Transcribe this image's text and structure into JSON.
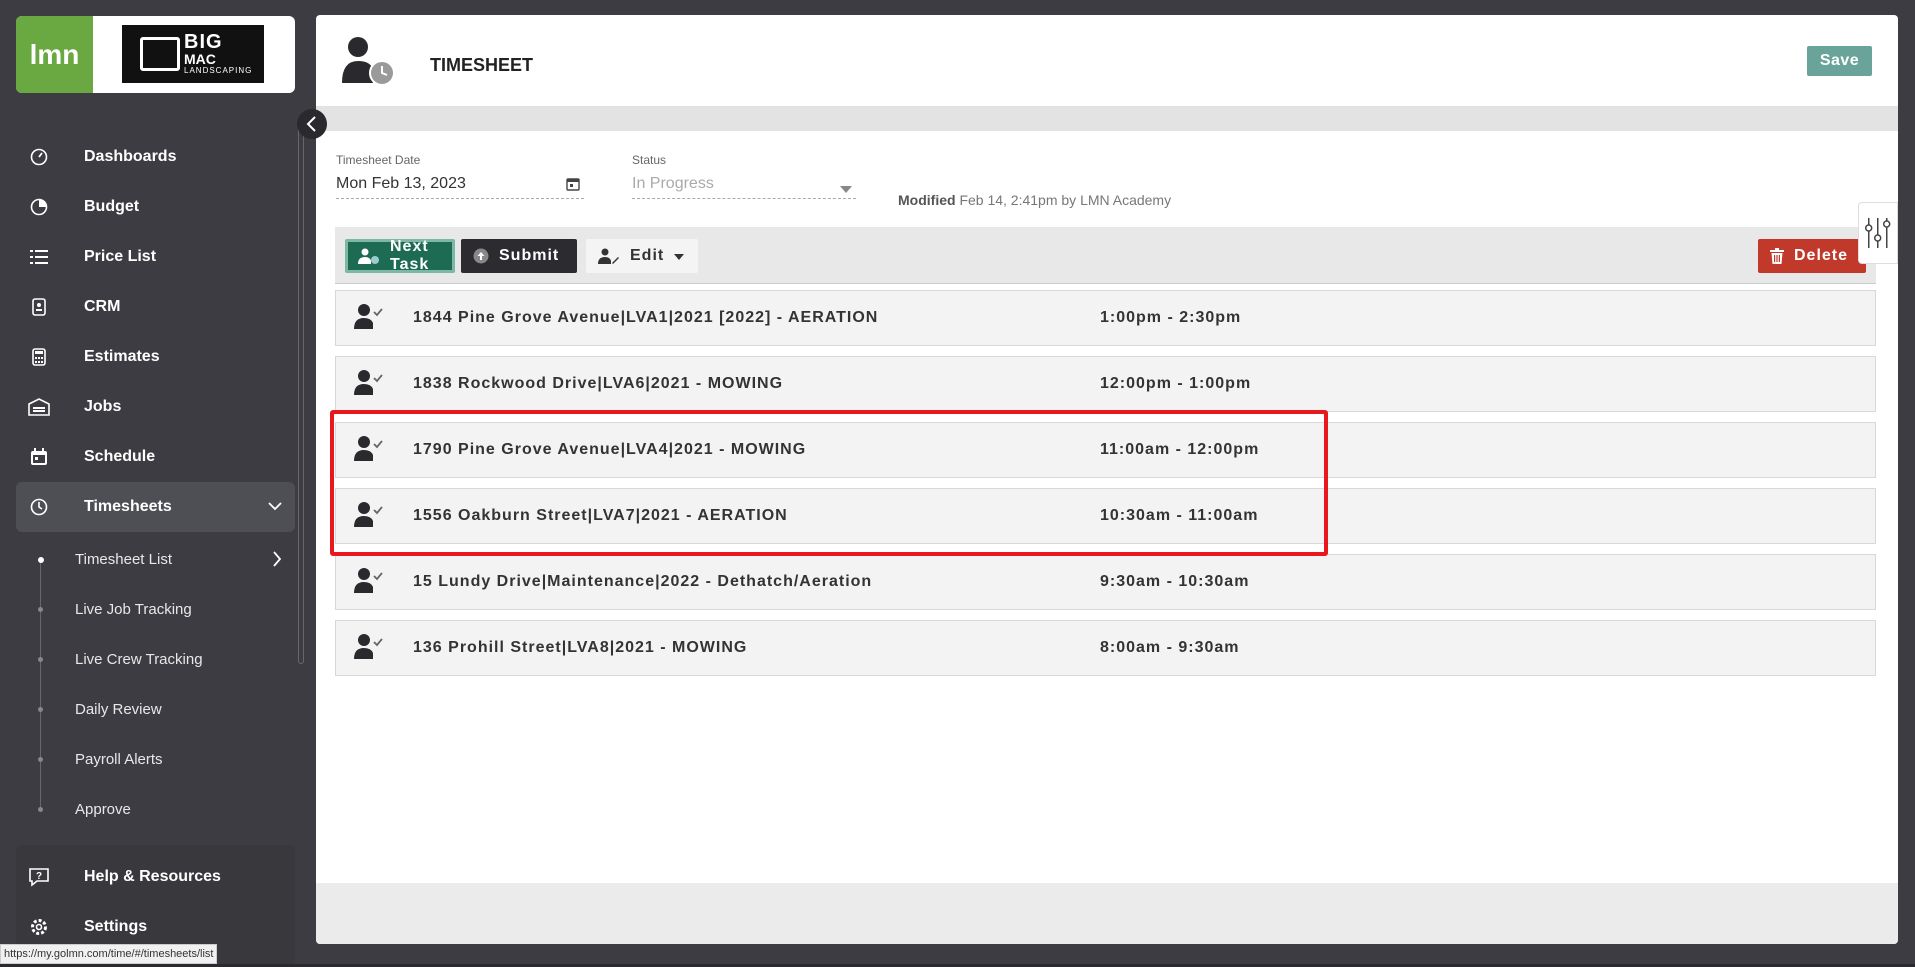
{
  "sidebar": {
    "logo_lmn": "lmn",
    "logo_big_line1": "BIG",
    "logo_big_line2": "MAC",
    "logo_big_line3": "LANDSCAPING",
    "nav": [
      {
        "label": "Dashboards",
        "icon": "gauge-icon"
      },
      {
        "label": "Budget",
        "icon": "pie-chart-icon"
      },
      {
        "label": "Price List",
        "icon": "list-icon"
      },
      {
        "label": "CRM",
        "icon": "contact-card-icon"
      },
      {
        "label": "Estimates",
        "icon": "calculator-icon"
      },
      {
        "label": "Jobs",
        "icon": "garage-icon"
      },
      {
        "label": "Schedule",
        "icon": "calendar-icon"
      },
      {
        "label": "Timesheets",
        "icon": "clock-icon"
      }
    ],
    "sub_items": [
      {
        "label": "Timesheet List"
      },
      {
        "label": "Live Job Tracking"
      },
      {
        "label": "Live Crew Tracking"
      },
      {
        "label": "Daily Review"
      },
      {
        "label": "Payroll Alerts"
      },
      {
        "label": "Approve"
      }
    ],
    "bottom": [
      {
        "label": "Help & Resources",
        "icon": "help-icon"
      },
      {
        "label": "Settings",
        "icon": "gear-icon"
      }
    ]
  },
  "status_url": "https://my.golmn.com/time/#/timesheets/list",
  "header": {
    "title": "TIMESHEET",
    "save_label": "Save"
  },
  "form": {
    "date_label": "Timesheet Date",
    "date_value": "Mon Feb 13, 2023",
    "status_label": "Status",
    "status_value": "In Progress",
    "modified_label": "Modified",
    "modified_value": "Feb 14, 2:41pm by LMN Academy"
  },
  "toolbar": {
    "next_task": "Next Task",
    "submit": "Submit",
    "edit": "Edit",
    "delete": "Delete"
  },
  "tasks": [
    {
      "name": "1844 Pine Grove Avenue|LVA1|2021 [2022] - AERATION",
      "time": "1:00pm - 2:30pm"
    },
    {
      "name": "1838 Rockwood Drive|LVA6|2021 - MOWING",
      "time": "12:00pm - 1:00pm"
    },
    {
      "name": "1790 Pine Grove Avenue|LVA4|2021 - MOWING",
      "time": "11:00am - 12:00pm"
    },
    {
      "name": "1556 Oakburn Street|LVA7|2021 - AERATION",
      "time": "10:30am - 11:00am"
    },
    {
      "name": "15 Lundy Drive|Maintenance|2022 - Dethatch/Aeration",
      "time": "9:30am - 10:30am"
    },
    {
      "name": "136 Prohill Street|LVA8|2021 - MOWING",
      "time": "8:00am - 9:30am"
    }
  ],
  "colors": {
    "brand_green": "#6aa842",
    "next_task_bg": "#1e6b54",
    "delete_bg": "#c0392b",
    "highlight": "#e8181c"
  }
}
